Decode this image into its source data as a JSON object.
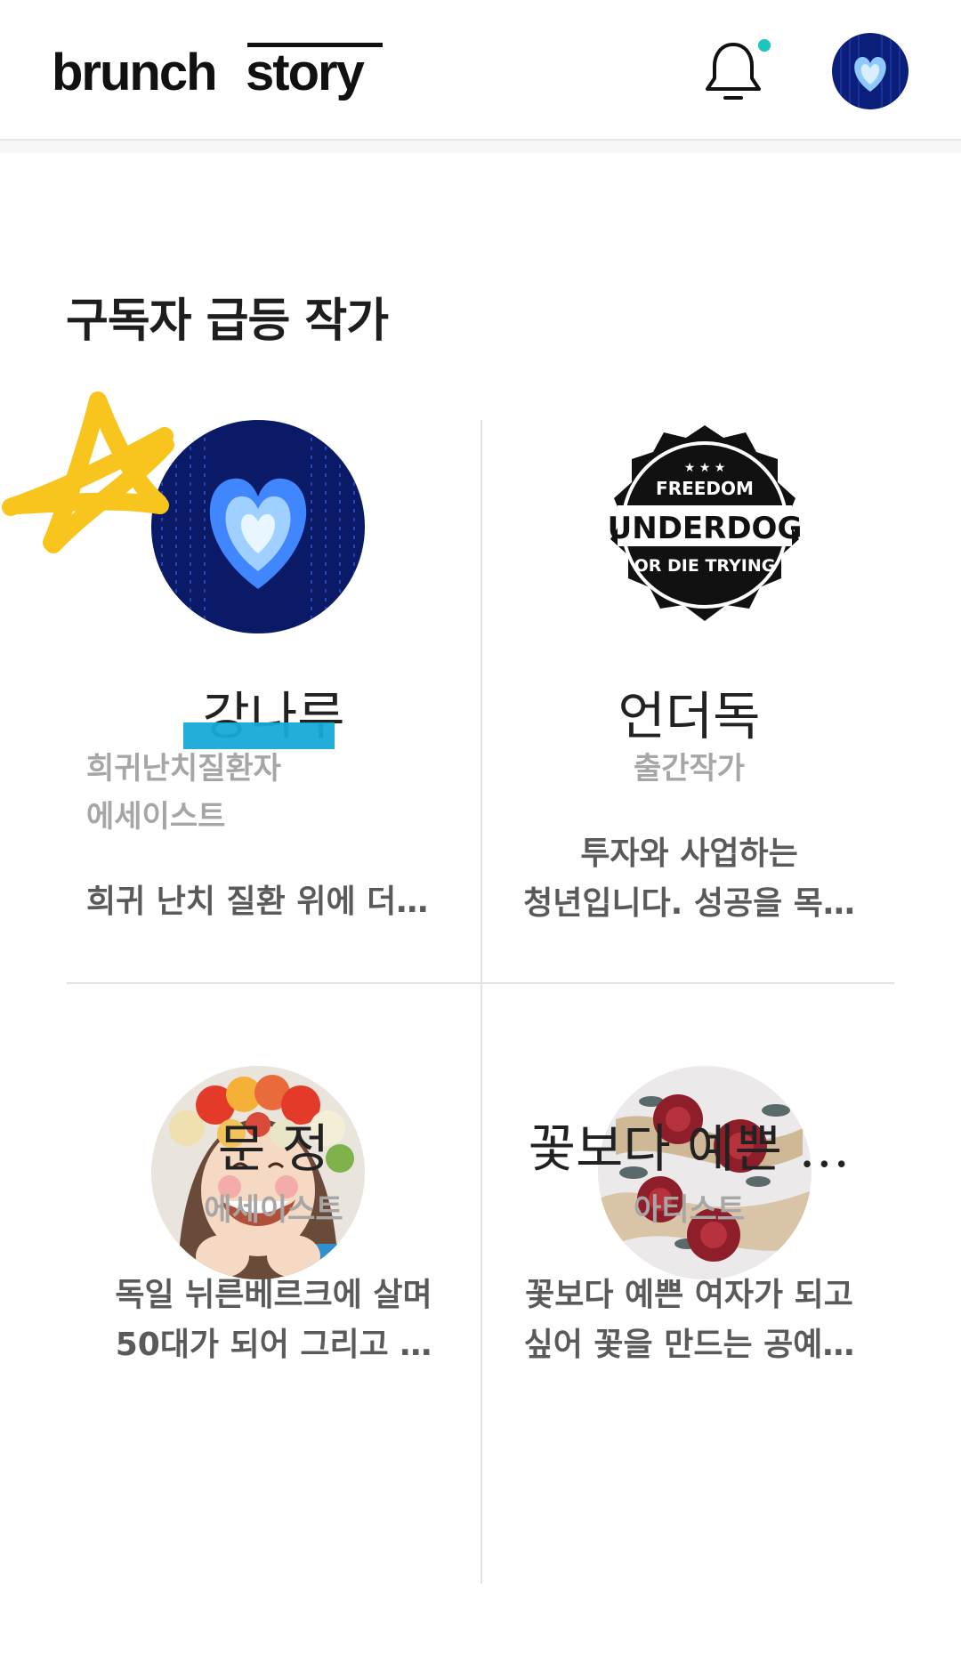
{
  "header": {
    "logo_word1": "brunch",
    "logo_word2": "story",
    "notification_icon": "bell-icon",
    "accent_color": "#1bc5bd"
  },
  "section": {
    "title": "구독자 급등 작가"
  },
  "authors": [
    {
      "name": "강나루",
      "roles": [
        "희귀난치질환자",
        "에세이스트"
      ],
      "desc": [
        "희귀 난치 질환 위에 더…"
      ]
    },
    {
      "name": "언더독",
      "roles": [
        "출간작가"
      ],
      "desc": [
        "투자와 사업하는",
        "청년입니다. 성공을 목…"
      ],
      "badge": {
        "top": "FREEDOM",
        "main": "UNDERDOG",
        "bottom": "OR DIE TRYING"
      }
    },
    {
      "name": "문 정",
      "roles": [
        "에세이스트"
      ],
      "desc": [
        "독일 뉘른베르크에 살며",
        "50대가 되어 그리고 …"
      ]
    },
    {
      "name": "꽃보다 예쁜 …",
      "roles": [
        "아티스트"
      ],
      "desc": [
        "꽃보다 예쁜 여자가 되고",
        "싶어 꽃을 만드는 공예…"
      ]
    }
  ]
}
